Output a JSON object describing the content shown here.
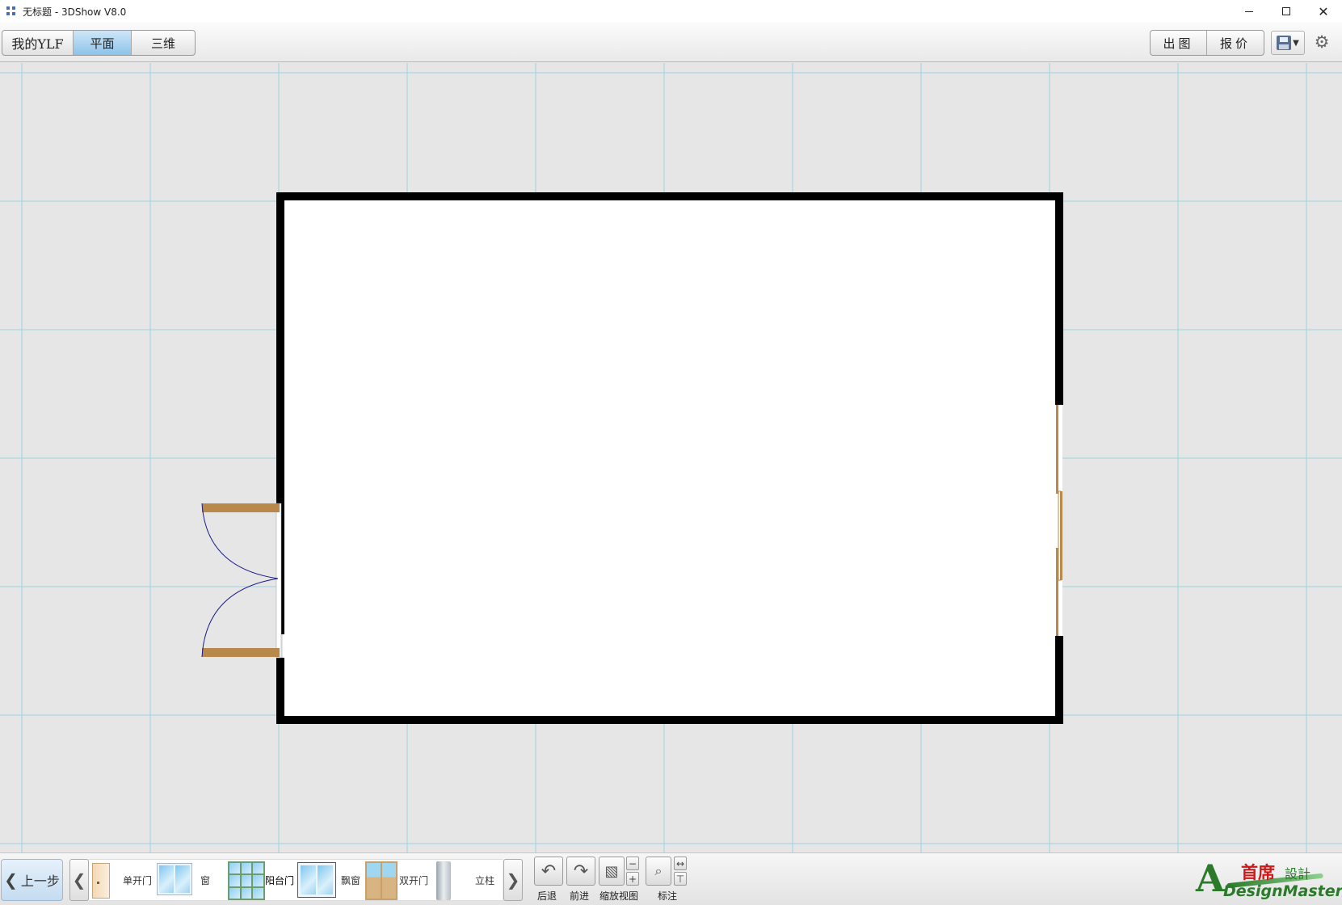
{
  "window": {
    "title": "无标题 - 3DShow V8.0"
  },
  "toolbar": {
    "my_label": "我的YLF",
    "plan_label": "平面",
    "threed_label": "三维",
    "export_label": "出图",
    "quote_label": "报价"
  },
  "bottombar": {
    "prev_step": "上一步",
    "palette": [
      {
        "label": "单开门",
        "icon": "single-door-icon"
      },
      {
        "label": "窗",
        "icon": "window-icon"
      },
      {
        "label": "阳台门",
        "icon": "balcony-door-icon"
      },
      {
        "label": "飘窗",
        "icon": "bay-window-icon"
      },
      {
        "label": "双开门",
        "icon": "double-door-icon"
      },
      {
        "label": "立柱",
        "icon": "pillar-icon"
      }
    ],
    "tools": {
      "undo": "后退",
      "redo": "前进",
      "zoom": "缩放视图",
      "annotate": "标注"
    },
    "logo": {
      "cn": "首席",
      "cn2": "設計",
      "en": "DesignMaster"
    }
  },
  "colors": {
    "grid_line": "#9ed3e0",
    "canvas_bg": "#e6e6e6",
    "wall": "#000000",
    "door_leaf": "#b8894a",
    "door_arc": "#1a1a8c",
    "active_tab": "#8cc3ea"
  }
}
